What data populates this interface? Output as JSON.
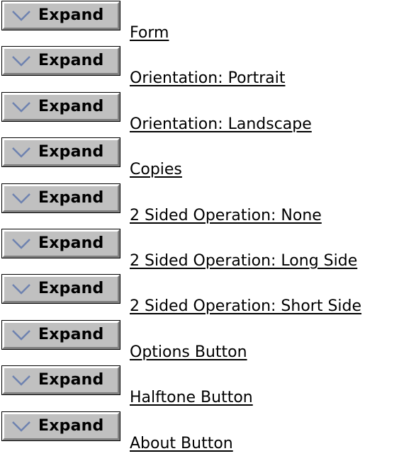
{
  "colors": {
    "button_face": "#c0c0c0",
    "chevron": "#6e82b0",
    "text": "#000000",
    "background": "#ffffff"
  },
  "rows": [
    {
      "button_label": "Expand",
      "button_icon": "chevron-down-icon",
      "link_text": "Form"
    },
    {
      "button_label": "Expand",
      "button_icon": "chevron-down-icon",
      "link_text": "Orientation: Portrait"
    },
    {
      "button_label": "Expand",
      "button_icon": "chevron-down-icon",
      "link_text": "Orientation: Landscape"
    },
    {
      "button_label": "Expand",
      "button_icon": "chevron-down-icon",
      "link_text": "Copies"
    },
    {
      "button_label": "Expand",
      "button_icon": "chevron-down-icon",
      "link_text": "2 Sided Operation: None"
    },
    {
      "button_label": "Expand",
      "button_icon": "chevron-down-icon",
      "link_text": "2 Sided Operation: Long Side"
    },
    {
      "button_label": "Expand",
      "button_icon": "chevron-down-icon",
      "link_text": "2 Sided Operation: Short Side"
    },
    {
      "button_label": "Expand",
      "button_icon": "chevron-down-icon",
      "link_text": "Options Button"
    },
    {
      "button_label": "Expand",
      "button_icon": "chevron-down-icon",
      "link_text": "Halftone Button"
    },
    {
      "button_label": "Expand",
      "button_icon": "chevron-down-icon",
      "link_text": "About Button"
    }
  ]
}
